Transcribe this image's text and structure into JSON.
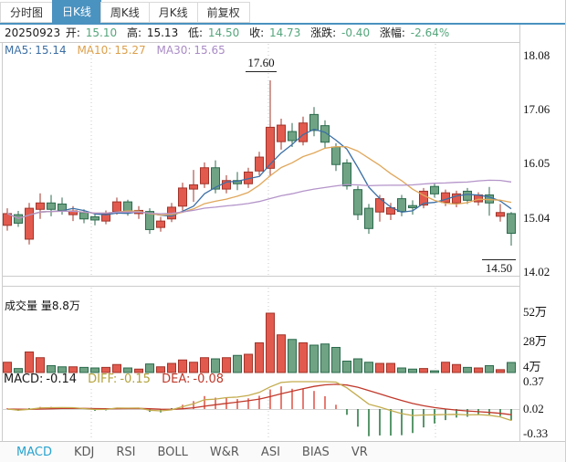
{
  "tabs": [
    {
      "label": "分时图",
      "active": false
    },
    {
      "label": "日K线",
      "active": true
    },
    {
      "label": "周K线",
      "active": false
    },
    {
      "label": "月K线",
      "active": false
    },
    {
      "label": "前复权",
      "active": false
    }
  ],
  "info": {
    "date": "20250923",
    "open_label": "开:",
    "open": "15.10",
    "high_label": "高:",
    "high": "15.13",
    "low_label": "低:",
    "low": "14.50",
    "close_label": "收:",
    "close": "14.73",
    "change_label": "涨跌:",
    "change": "-0.40",
    "change_pct_label": "涨幅:",
    "change_pct": "-2.64%"
  },
  "ma_legend": [
    {
      "label": "MA5:",
      "value": "15.14"
    },
    {
      "label": "MA10:",
      "value": "15.27"
    },
    {
      "label": "MA30:",
      "value": "15.65"
    }
  ],
  "volume_title": "成交量 量8.8万",
  "macd_legend": [
    {
      "label": "MACD:",
      "value": "-0.14"
    },
    {
      "label": "DIFF:",
      "value": "-0.15"
    },
    {
      "label": "DEA:",
      "value": "-0.08"
    }
  ],
  "axis": {
    "price": [
      "18.08",
      "17.06",
      "16.05",
      "15.04",
      "14.02"
    ],
    "volume": [
      "52万",
      "28万",
      "4万"
    ],
    "macd": [
      "0.37",
      "0.02",
      "-0.33"
    ]
  },
  "annotations": {
    "high": "17.60",
    "low": "14.50"
  },
  "indicator_tabs": [
    {
      "label": "MACD",
      "active": true
    },
    {
      "label": "KDJ",
      "active": false
    },
    {
      "label": "RSI",
      "active": false
    },
    {
      "label": "BOLL",
      "active": false
    },
    {
      "label": "W&R",
      "active": false
    },
    {
      "label": "ASI",
      "active": false
    },
    {
      "label": "BIAS",
      "active": false
    },
    {
      "label": "VR",
      "active": false
    }
  ],
  "colors": {
    "accent_blue": "#4a92c0",
    "active_indicator": "#29a3cf",
    "text_green": "#55a57c",
    "up_fill": "#e25a4e",
    "up_stroke": "#a2342a",
    "down_fill": "#6fa383",
    "down_stroke": "#2c6b4e",
    "ma5": "#3c6fa5",
    "ma10": "#e0a75a",
    "ma30": "#b494c9",
    "diff_line": "#c3ac4e",
    "dea_line": "#c0392b",
    "grid": "#c8c8c8",
    "border": "#cccccc",
    "zero_line": "#d5d5d5"
  },
  "chart_data": {
    "type": "candlestick",
    "title": "日K线",
    "panes": [
      "price",
      "volume",
      "macd"
    ],
    "price_ticks": [
      18.08,
      17.06,
      16.05,
      15.04,
      14.02
    ],
    "price_ylim": [
      13.93,
      18.3
    ],
    "volume_ticks_wan": [
      52,
      28,
      4
    ],
    "volume_unit": "万",
    "macd_ticks": [
      0.37,
      0.02,
      -0.33
    ],
    "high_marker": 17.6,
    "low_marker": 14.5,
    "last_values": {
      "macd": -0.14,
      "diff": -0.15,
      "dea": -0.08,
      "volume_wan": 8.8
    },
    "ma_periods": [
      5,
      10,
      30
    ],
    "grid": "vertical-dotted",
    "columns": [
      "open",
      "high",
      "low",
      "close",
      "volume_wan"
    ],
    "candles": [
      [
        14.88,
        15.2,
        14.78,
        15.1,
        9
      ],
      [
        15.08,
        15.15,
        14.85,
        14.92,
        3.5
      ],
      [
        14.62,
        15.3,
        14.52,
        15.2,
        18
      ],
      [
        15.18,
        15.48,
        15.0,
        15.3,
        13
      ],
      [
        15.3,
        15.45,
        15.05,
        15.18,
        6
      ],
      [
        15.28,
        15.4,
        15.08,
        15.16,
        5
      ],
      [
        15.08,
        15.24,
        14.96,
        15.15,
        5
      ],
      [
        15.12,
        15.18,
        14.92,
        15.0,
        4.5
      ],
      [
        15.04,
        15.1,
        14.88,
        14.98,
        4
      ],
      [
        14.96,
        15.16,
        14.9,
        15.1,
        4.5
      ],
      [
        15.14,
        15.4,
        15.08,
        15.32,
        7
      ],
      [
        15.32,
        15.36,
        15.06,
        15.12,
        4
      ],
      [
        15.1,
        15.24,
        15.0,
        15.16,
        3
      ],
      [
        15.14,
        15.2,
        14.72,
        14.8,
        7.5
      ],
      [
        14.84,
        15.04,
        14.76,
        14.96,
        5
      ],
      [
        15.0,
        15.3,
        14.94,
        15.22,
        8
      ],
      [
        15.24,
        15.68,
        15.16,
        15.58,
        11
      ],
      [
        15.56,
        15.92,
        15.32,
        15.64,
        9
      ],
      [
        15.66,
        16.06,
        15.58,
        15.96,
        13
      ],
      [
        15.96,
        16.1,
        15.48,
        15.56,
        12
      ],
      [
        15.56,
        15.82,
        15.48,
        15.72,
        13
      ],
      [
        15.72,
        15.88,
        15.54,
        15.66,
        15
      ],
      [
        15.66,
        15.96,
        15.58,
        15.88,
        16
      ],
      [
        15.9,
        16.26,
        15.82,
        16.16,
        26
      ],
      [
        15.95,
        17.6,
        15.8,
        16.72,
        52
      ],
      [
        16.45,
        16.88,
        16.3,
        16.76,
        33
      ],
      [
        16.64,
        16.8,
        16.35,
        16.47,
        29
      ],
      [
        16.45,
        16.92,
        16.38,
        16.8,
        26
      ],
      [
        16.96,
        17.1,
        16.55,
        16.66,
        24
      ],
      [
        16.75,
        16.85,
        16.32,
        16.44,
        25
      ],
      [
        16.35,
        16.42,
        15.9,
        16.02,
        22
      ],
      [
        16.05,
        16.12,
        15.55,
        15.62,
        10
      ],
      [
        15.55,
        15.62,
        14.98,
        15.08,
        12
      ],
      [
        15.2,
        15.28,
        14.72,
        14.82,
        9
      ],
      [
        15.13,
        15.45,
        14.95,
        15.38,
        8
      ],
      [
        15.09,
        15.3,
        14.98,
        15.21,
        8
      ],
      [
        15.38,
        15.45,
        15.05,
        15.14,
        4
      ],
      [
        15.25,
        15.35,
        15.08,
        15.21,
        3
      ],
      [
        15.26,
        15.58,
        15.2,
        15.52,
        3.5
      ],
      [
        15.61,
        15.68,
        15.4,
        15.47,
        1.5
      ],
      [
        15.31,
        15.55,
        15.24,
        15.49,
        9
      ],
      [
        15.3,
        15.53,
        15.22,
        15.47,
        7
      ],
      [
        15.52,
        15.58,
        15.28,
        15.35,
        4.5
      ],
      [
        15.32,
        15.5,
        15.25,
        15.45,
        4
      ],
      [
        15.45,
        15.6,
        15.06,
        15.3,
        6
      ],
      [
        15.05,
        15.28,
        14.95,
        15.12,
        2.5
      ],
      [
        15.1,
        15.13,
        14.5,
        14.73,
        8.8
      ]
    ]
  }
}
